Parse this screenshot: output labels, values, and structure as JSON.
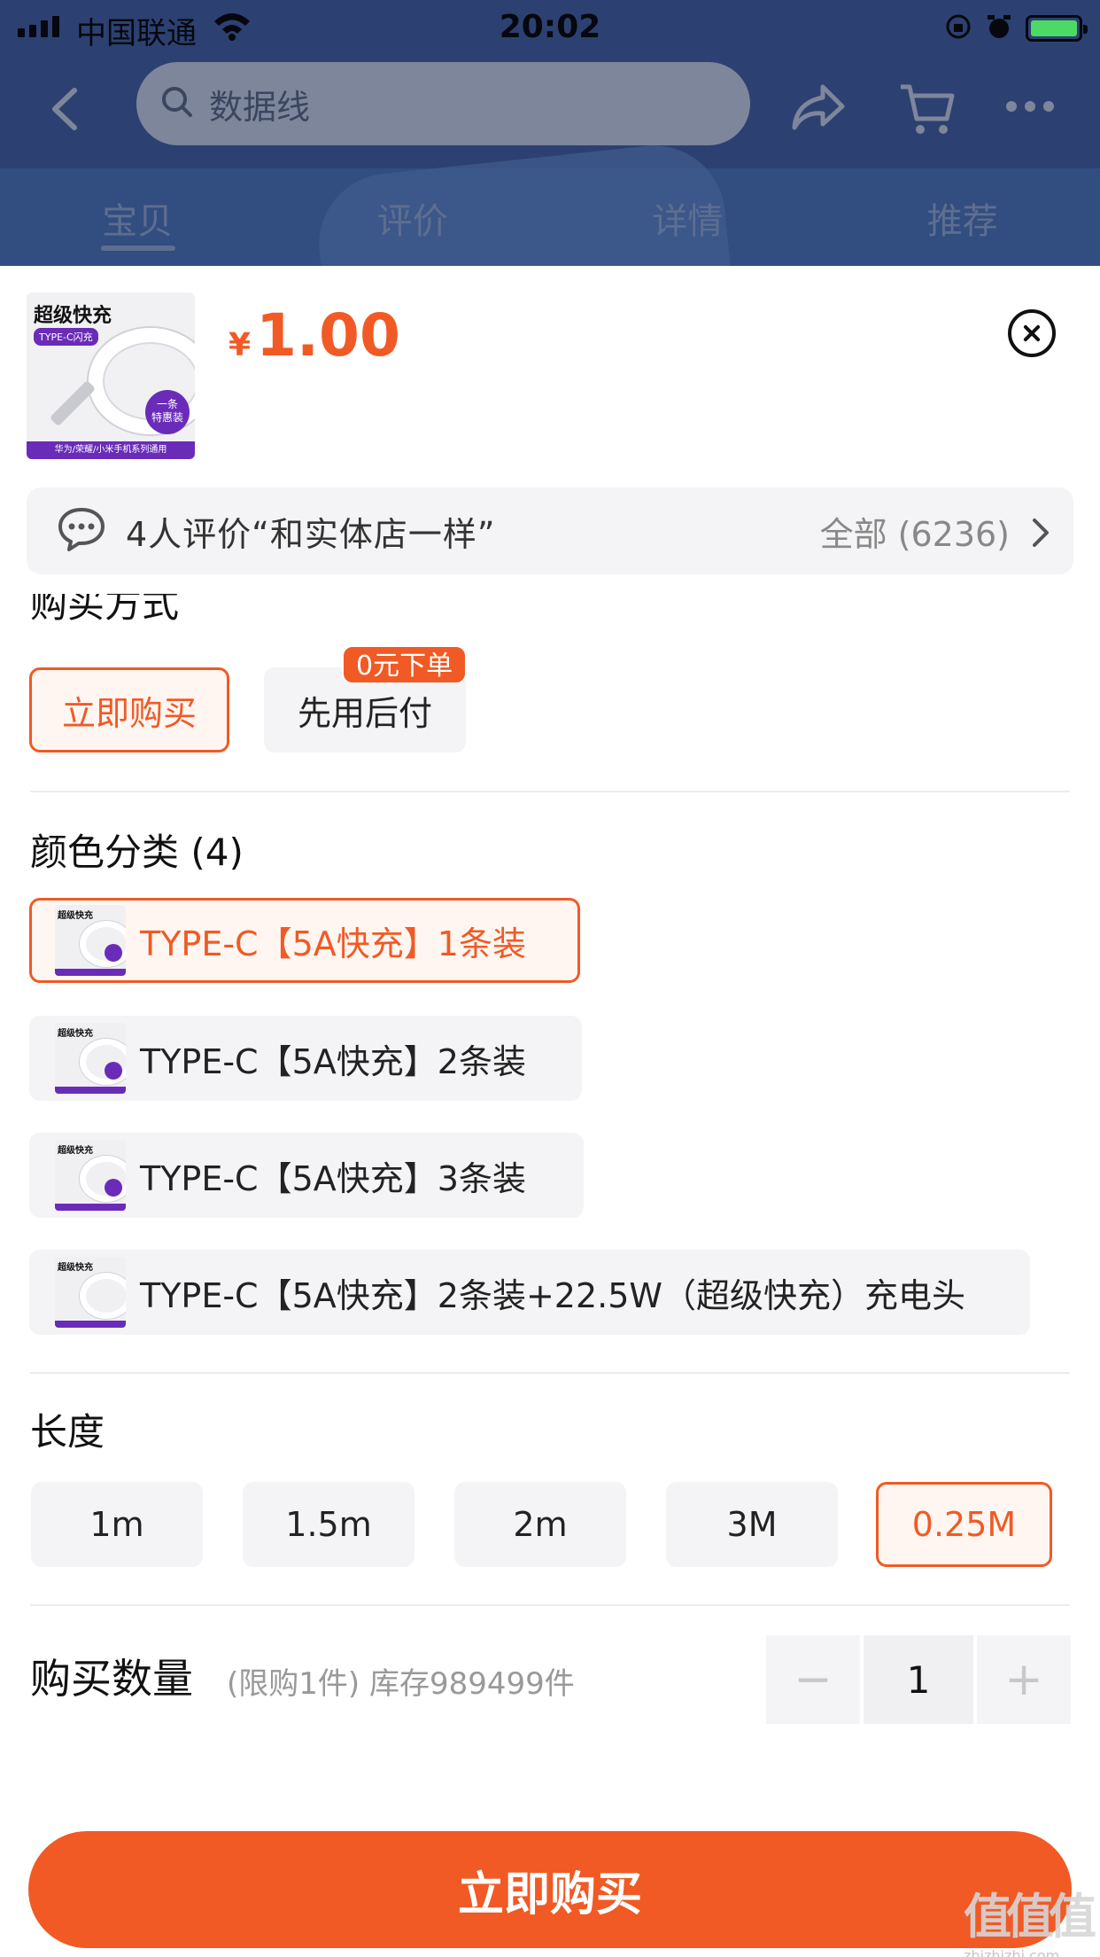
{
  "status_bar": {
    "carrier": "中国联通",
    "time": "20:02"
  },
  "nav": {
    "search_query": "数据线"
  },
  "tabs": [
    {
      "label": "宝贝",
      "active": true
    },
    {
      "label": "评价",
      "active": false
    },
    {
      "label": "详情",
      "active": false
    },
    {
      "label": "推荐",
      "active": false
    }
  ],
  "product": {
    "thumb_title": "超级快充",
    "thumb_badge": "TYPE-C闪充",
    "thumb_circle": "一条\n特惠装",
    "thumb_footer": "华为/荣耀/小米手机系列通用",
    "currency": "¥",
    "price": "1.00"
  },
  "review": {
    "text": "4人评价“和实体店一样”",
    "all": "全部 (6236)"
  },
  "purchase_method": {
    "title": "购买方式",
    "options": [
      {
        "label": "立即购买",
        "selected": true
      },
      {
        "label": "先用后付",
        "selected": false
      }
    ],
    "tag": "0元下单"
  },
  "color": {
    "title": "颜色分类 (4)",
    "options": [
      {
        "label": "TYPE-C【5A快充】1条装",
        "selected": true
      },
      {
        "label": "TYPE-C【5A快充】2条装",
        "selected": false
      },
      {
        "label": "TYPE-C【5A快充】3条装",
        "selected": false
      },
      {
        "label": "TYPE-C【5A快充】2条装+22.5W（超级快充）充电头",
        "selected": false
      }
    ]
  },
  "length": {
    "title": "长度",
    "options": [
      {
        "label": "1m",
        "selected": false
      },
      {
        "label": "1.5m",
        "selected": false
      },
      {
        "label": "2m",
        "selected": false
      },
      {
        "label": "3M",
        "selected": false
      },
      {
        "label": "0.25M",
        "selected": true
      }
    ]
  },
  "quantity": {
    "label": "购买数量",
    "note": "(限购1件) 库存989499件",
    "value": "1",
    "minus": "−",
    "plus": "+"
  },
  "cta": {
    "label": "立即购买"
  },
  "watermark": {
    "logo": "值值值",
    "url": "zhizhizhi.com"
  },
  "colors": {
    "accent": "#f15a24",
    "nav_bg": "#2c4171"
  }
}
